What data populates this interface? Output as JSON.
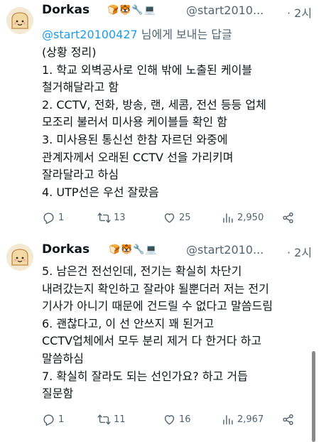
{
  "tweets": [
    {
      "name": "Dorkas",
      "badges": "🍞🐯🔧💻",
      "handle": "@start2010...",
      "time": "· 2시",
      "replying_to": {
        "handle": "@start20100427",
        "suffix": " 님에게 보내는 답글"
      },
      "lines": [
        "(상황 정리)",
        "1. 학교 외벽공사로 인해 밖에 노출된 케이블",
        "철거해달라고 함",
        "2. CCTV, 전화, 방송, 랜, 세콤, 전선 등등 업체",
        "모조리 불러서 미사용 케이블들 확인 함",
        "3. 미사용된 통신선 한참 자르던 와중에",
        "관계자께서 오래된 CCTV 선을 가리키며",
        "잘라달라고 하심",
        "4. UTP선은 우선 잘랐음"
      ],
      "replies": "1",
      "retweets": "13",
      "likes": "25",
      "views": "2,950"
    },
    {
      "name": "Dorkas",
      "badges": "🍞🐯🔧💻",
      "handle": "@start2010...",
      "time": "· 2시",
      "lines": [
        "5. 남은건 전선인데, 전기는 확실히 차단기",
        "내려갔는지 확인하고 잘라야 될뿐더러 저는 전기",
        "기사가 아니기 때문에 건드릴 수 없다고 말씀드림",
        "6. 괜찮다고, 이 선 안쓰지 꽤 된거고",
        "CCTV업체에서 모두 분리 제거 다 한거다 하고",
        "말씀하심",
        "7. 확실히 잘라도 되는 선인가요? 하고 거듭",
        "질문함"
      ],
      "replies": "1",
      "retweets": "11",
      "likes": "16",
      "views": "2,967"
    }
  ],
  "icons": {
    "reply": "reply-icon",
    "retweet": "retweet-icon",
    "like": "heart-icon",
    "views": "views-icon",
    "share": "share-icon",
    "more": "more-icon"
  },
  "colors": {
    "link": "#1d9bf0",
    "muted": "#536471",
    "text": "#0f1419"
  }
}
